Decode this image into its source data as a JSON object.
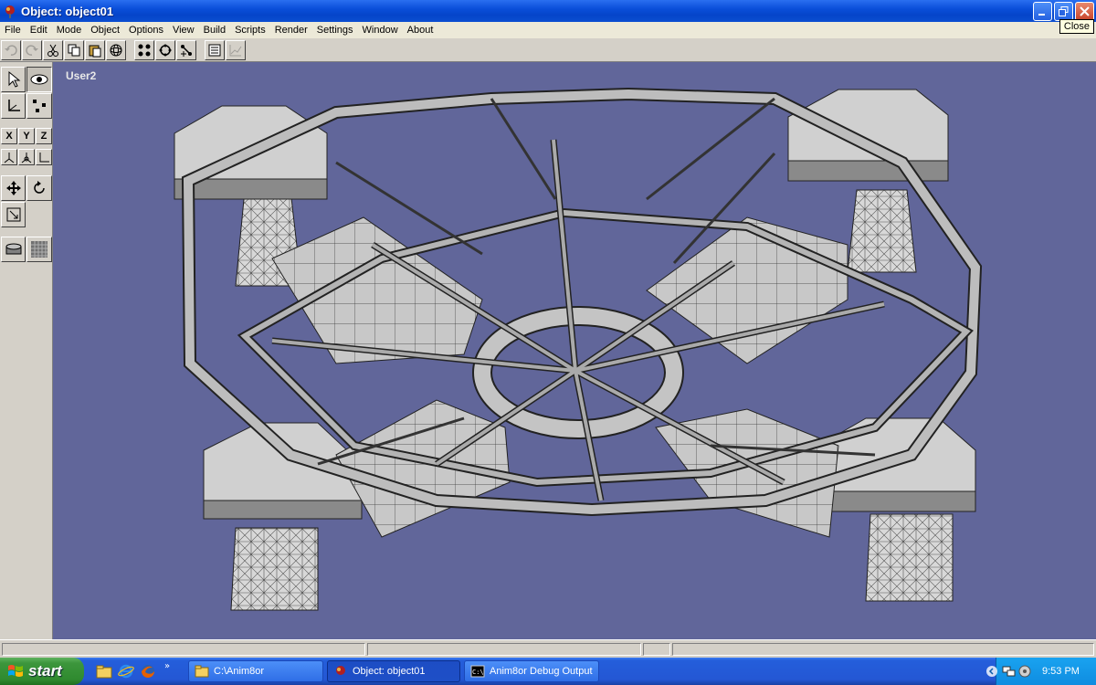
{
  "window": {
    "title": "Object: object01",
    "close_tooltip": "Close"
  },
  "menu": [
    "File",
    "Edit",
    "Mode",
    "Object",
    "Options",
    "View",
    "Build",
    "Scripts",
    "Render",
    "Settings",
    "Window",
    "About"
  ],
  "toolbar": {
    "icons": [
      "undo-icon",
      "redo-icon",
      "cut-icon",
      "copy-icon",
      "paste-icon",
      "sphere-icon",
      "points-icon",
      "rotate-icon",
      "scale-icon",
      "list-icon",
      "graph-icon"
    ]
  },
  "left_panel": {
    "axis_buttons": [
      "X",
      "Y",
      "Z"
    ]
  },
  "viewport": {
    "label": "User2",
    "background": "#61669a"
  },
  "taskbar": {
    "start_label": "start",
    "tasks": [
      {
        "label": "C:\\Anim8or",
        "icon": "folder-icon"
      },
      {
        "label": "Object: object01",
        "icon": "anim8or-icon"
      },
      {
        "label": "Anim8or Debug Output",
        "icon": "console-icon"
      }
    ],
    "clock": "9:53 PM"
  }
}
